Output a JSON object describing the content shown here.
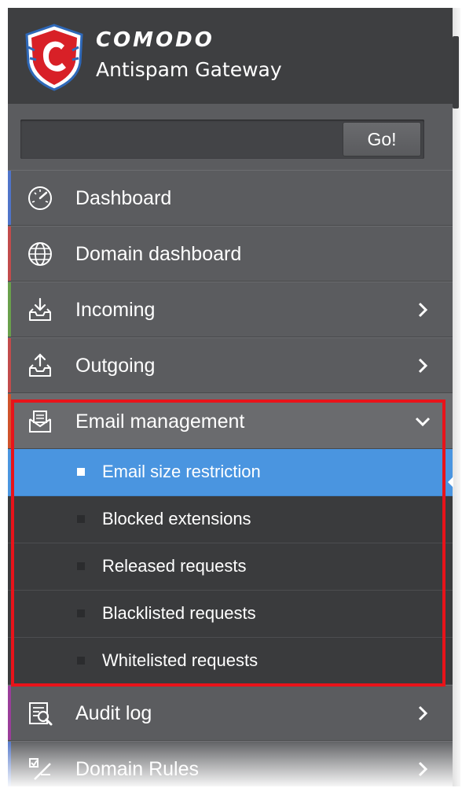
{
  "app": {
    "brand": "COMODO",
    "product": "Antispam Gateway"
  },
  "search": {
    "value": "",
    "placeholder": "",
    "go_label": "Go!"
  },
  "menu": {
    "items": [
      {
        "label": "Dashboard",
        "icon": "dashboard-gauge-icon",
        "accent": "#4f74c9",
        "has_submenu": false
      },
      {
        "label": "Domain dashboard",
        "icon": "globe-icon",
        "accent": "#c24b4b",
        "has_submenu": false
      },
      {
        "label": "Incoming",
        "icon": "incoming-tray-icon",
        "accent": "#69a04b",
        "has_submenu": true
      },
      {
        "label": "Outgoing",
        "icon": "outgoing-tray-icon",
        "accent": "#c24b4b",
        "has_submenu": true
      },
      {
        "label": "Email management",
        "icon": "email-management-icon",
        "accent": "#d0532b",
        "has_submenu": true,
        "expanded": true
      },
      {
        "label": "Audit log",
        "icon": "audit-log-icon",
        "accent": "#9a3e9a",
        "has_submenu": true
      },
      {
        "label": "Domain Rules",
        "icon": "domain-rules-icon",
        "accent": "#4f74c9",
        "has_submenu": true
      }
    ],
    "email_management_sub": [
      {
        "label": "Email size restriction",
        "active": true
      },
      {
        "label": "Blocked extensions",
        "active": false
      },
      {
        "label": "Released requests",
        "active": false
      },
      {
        "label": "Blacklisted requests",
        "active": false
      },
      {
        "label": "Whitelisted requests",
        "active": false
      }
    ]
  },
  "colors": {
    "sidebar_bg": "#5b5c5f",
    "header_bg": "#3e3f41",
    "submenu_bg": "#3a3b3d",
    "active_bg": "#4a95e0",
    "highlight_border": "#e8131a"
  }
}
